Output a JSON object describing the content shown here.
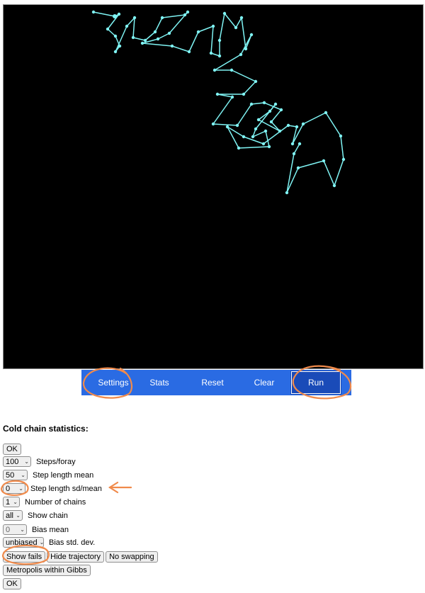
{
  "toolbar": {
    "settings": "Settings",
    "stats": "Stats",
    "reset": "Reset",
    "clear": "Clear",
    "run": "Run"
  },
  "stats_title": "Cold chain statistics:",
  "buttons": {
    "ok_top": "OK",
    "show_fails": "Show fails",
    "hide_trajectory": "Hide trajectory",
    "no_swapping": "No swapping",
    "metropolis": "Metropolis within Gibbs",
    "ok_bottom": "OK"
  },
  "settings": [
    {
      "value": "100",
      "label": "Steps/foray"
    },
    {
      "value": "50",
      "label": "Step length mean"
    },
    {
      "value": "0",
      "label": "Step length sd/mean"
    },
    {
      "value": "1",
      "label": "Number of chains"
    },
    {
      "value": "all",
      "label": "Show chain"
    },
    {
      "value": "0",
      "label": "Bias mean"
    },
    {
      "value": "unbiased",
      "label": "Bias std. dev."
    }
  ],
  "colors": {
    "trajectory": "#7ff4f4",
    "toolbar": "#2a6be3",
    "run_active": "#1a4bb8",
    "annotation": "#f08a4b"
  }
}
